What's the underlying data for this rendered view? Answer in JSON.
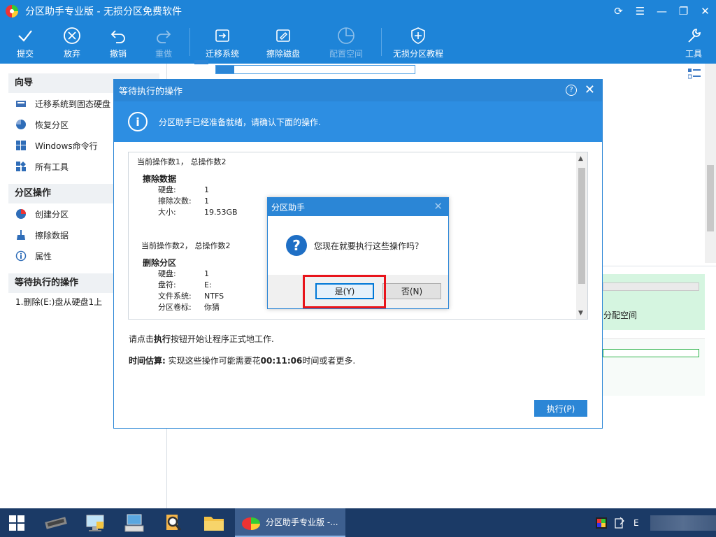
{
  "window": {
    "title": "分区助手专业版 - 无损分区免费软件"
  },
  "toolbar": {
    "commit": "提交",
    "discard": "放弃",
    "undo": "撤销",
    "redo": "重做",
    "migrate_os": "迁移系统",
    "wipe_disk": "擦除磁盘",
    "allocate_space": "配置空间",
    "tutorial": "无损分区教程",
    "tools": "工具"
  },
  "sidebar": {
    "wizard_head": "向导",
    "wizard_items": [
      {
        "label": "迁移系统到固态硬盘",
        "icon": "migrate-icon"
      },
      {
        "label": "恢复分区",
        "icon": "recover-icon"
      },
      {
        "label": "Windows命令行",
        "icon": "windows-icon"
      },
      {
        "label": "所有工具",
        "icon": "tools-grid-icon"
      }
    ],
    "partition_head": "分区操作",
    "partition_items": [
      {
        "label": "创建分区",
        "icon": "create-partition-icon"
      },
      {
        "label": "擦除数据",
        "icon": "wipe-icon"
      },
      {
        "label": "属性",
        "icon": "info-icon"
      }
    ],
    "pending_head": "等待执行的操作",
    "pending_items": [
      "1.删除(E:)盘从硬盘1上"
    ]
  },
  "background": {
    "unallocated_label": "分配空间"
  },
  "pending_dialog": {
    "title": "等待执行的操作",
    "banner": "分区助手已经准备就绪，请确认下面的操作.",
    "ops": {
      "op1_header": "当前操作数1， 总操作数2",
      "op1_title": "擦除数据",
      "op1_fields": [
        {
          "k": "硬盘:",
          "v": "1"
        },
        {
          "k": "擦除次数:",
          "v": "1"
        },
        {
          "k": "大小:",
          "v": "19.53GB"
        }
      ],
      "op2_header": "当前操作数2， 总操作数2",
      "op2_title": "删除分区",
      "op2_fields": [
        {
          "k": "硬盘:",
          "v": "1"
        },
        {
          "k": "盘符:",
          "v": "E:"
        },
        {
          "k": "文件系统:",
          "v": "NTFS"
        },
        {
          "k": "分区卷标:",
          "v": "你猜"
        }
      ]
    },
    "hint_prefix": "请点击",
    "hint_bold": "执行",
    "hint_suffix": "按钮开始让程序正式地工作.",
    "estimate_label": "时间估算:",
    "estimate_pre": " 实现这些操作可能需要花",
    "estimate_time": "00:11:06",
    "estimate_post": "时间或者更多.",
    "execute_button": "执行(P)"
  },
  "confirm_dialog": {
    "title": "分区助手",
    "message": "您现在就要执行这些操作吗？",
    "yes_button": "是(Y)",
    "no_button": "否(N)"
  },
  "taskbar": {
    "active_app_label": "分区助手专业版 -...",
    "tray_text": "E"
  },
  "colors": {
    "brand_blue": "#1e84d8",
    "highlight_red": "#e8141b"
  }
}
